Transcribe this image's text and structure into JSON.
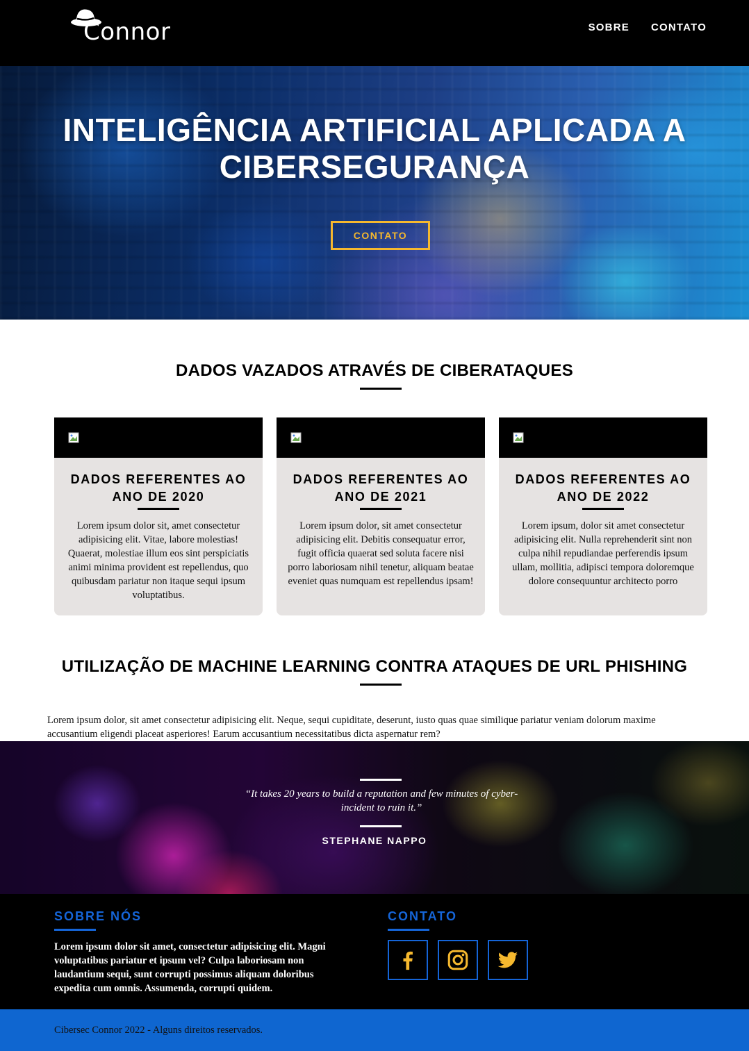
{
  "header": {
    "logo_text": "Connor",
    "nav": [
      {
        "label": "SOBRE"
      },
      {
        "label": "CONTATO"
      }
    ]
  },
  "hero": {
    "title_line1": "INTELIGÊNCIA ARTIFICIAL APLICADA A",
    "title_line2": "CIBERSEGURANÇA",
    "button_label": "CONTATO"
  },
  "leaks": {
    "title": "DADOS VAZADOS ATRAVÉS DE CIBERATAQUES",
    "cards": [
      {
        "title": "DADOS REFERENTES AO ANO DE 2020",
        "text": "Lorem ipsum dolor sit, amet consectetur adipisicing elit. Vitae, labore molestias! Quaerat, molestiae illum eos sint perspiciatis animi minima provident est repellendus, quo quibusdam pariatur non itaque sequi ipsum voluptatibus."
      },
      {
        "title": "DADOS REFERENTES AO ANO DE 2021",
        "text": "Lorem ipsum dolor, sit amet consectetur adipisicing elit. Debitis consequatur error, fugit officia quaerat sed soluta facere nisi porro laboriosam nihil tenetur, aliquam beatae eveniet quas numquam est repellendus ipsam!"
      },
      {
        "title": "DADOS REFERENTES AO ANO DE 2022",
        "text": "Lorem ipsum, dolor sit amet consectetur adipisicing elit. Nulla reprehenderit sint non culpa nihil repudiandae perferendis ipsum ullam, mollitia, adipisci tempora doloremque dolore consequuntur architecto porro"
      }
    ]
  },
  "ml": {
    "title": "UTILIZAÇÃO DE MACHINE LEARNING CONTRA ATAQUES DE URL PHISHING",
    "text": "Lorem ipsum dolor, sit amet consectetur adipisicing elit. Neque, sequi cupiditate, deserunt, iusto quas quae similique pariatur veniam dolorum maxime accusantium eligendi placeat asperiores! Earum accusantium necessitatibus dicta aspernatur rem?"
  },
  "quote": {
    "text": "“It takes 20 years to build a reputation and few minutes of cyber-incident to ruin it.”",
    "author": "STEPHANE NAPPO"
  },
  "footer": {
    "about_title": "SOBRE NÓS",
    "about_text": "Lorem ipsum dolor sit amet, consectetur adipisicing elit. Magni voluptatibus pariatur et ipsum vel? Culpa laboriosam non laudantium sequi, sunt corrupti possimus aliquam doloribus expedita cum omnis. Assumenda, corrupti quidem.",
    "contact_title": "CONTATO",
    "social_icons": [
      "facebook-icon",
      "instagram-icon",
      "twitter-icon"
    ],
    "copyright": "Cibersec Connor 2022 - Alguns direitos reservados."
  },
  "colors": {
    "accent_yellow": "#f5b82e",
    "accent_blue": "#1565d8",
    "bottom_bar": "#0f66d0",
    "card_bg": "#e6e3e2"
  }
}
